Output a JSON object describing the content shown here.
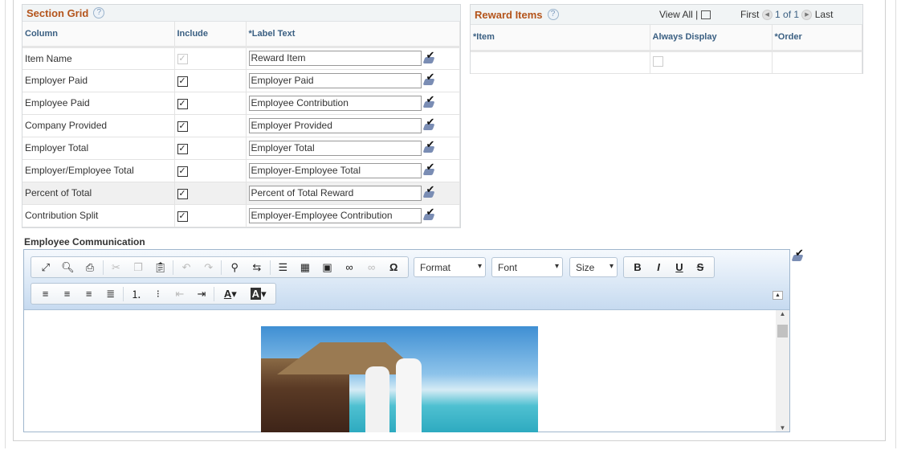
{
  "section_grid": {
    "title": "Section Grid",
    "columns": [
      "Column",
      "Include",
      "*Label Text"
    ],
    "rows": [
      {
        "column": "Item Name",
        "include": true,
        "disabled": true,
        "label": "Reward Item"
      },
      {
        "column": "Employer Paid",
        "include": true,
        "label": "Employer Paid"
      },
      {
        "column": "Employee Paid",
        "include": true,
        "label": "Employee Contribution"
      },
      {
        "column": "Company Provided",
        "include": true,
        "label": "Employer Provided"
      },
      {
        "column": "Employer Total",
        "include": true,
        "label": "Employer Total"
      },
      {
        "column": "Employer/Employee Total",
        "include": true,
        "label": "Employer-Employee Total"
      },
      {
        "column": "Percent of Total",
        "include": true,
        "label": "Percent of Total Reward"
      },
      {
        "column": "Contribution Split",
        "include": true,
        "label": "Employer-Employee Contribution"
      }
    ]
  },
  "reward_items": {
    "title": "Reward Items",
    "view_all": "View All",
    "first": "First",
    "page": "1 of 1",
    "last": "Last",
    "columns": [
      "*Item",
      "Always Display",
      "*Order"
    ]
  },
  "communication": {
    "label": "Employee Communication",
    "format": "Format",
    "font": "Font",
    "size": "Size"
  }
}
